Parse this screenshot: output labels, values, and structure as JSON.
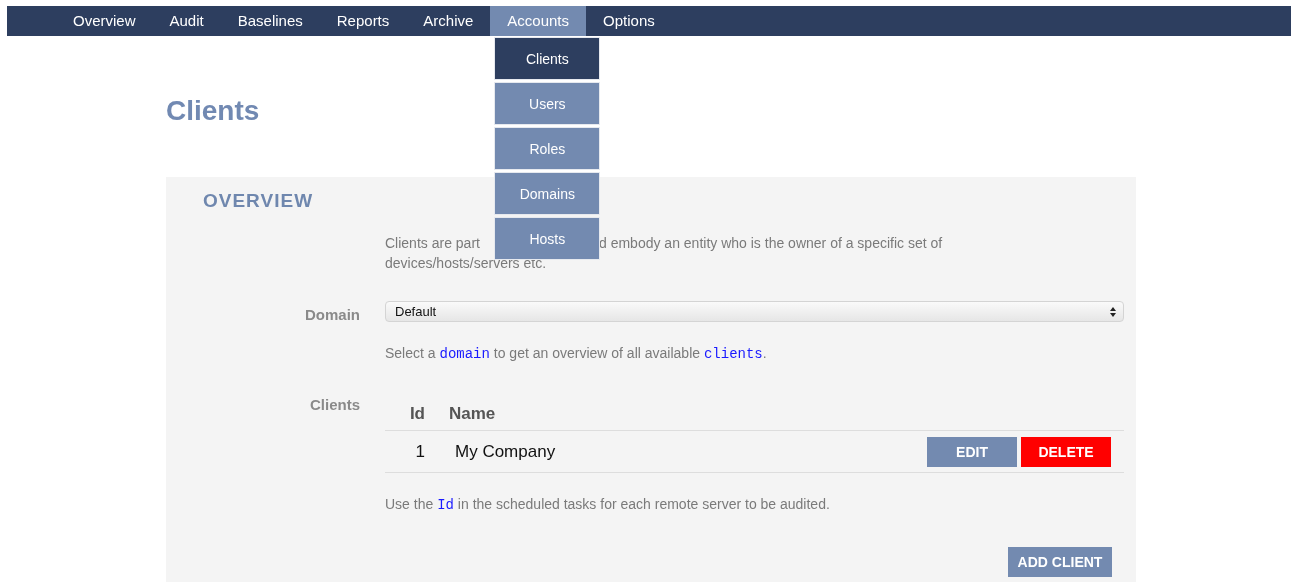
{
  "nav": {
    "items": [
      {
        "label": "Overview",
        "selected": false
      },
      {
        "label": "Audit",
        "selected": false
      },
      {
        "label": "Baselines",
        "selected": false
      },
      {
        "label": "Reports",
        "selected": false
      },
      {
        "label": "Archive",
        "selected": false
      },
      {
        "label": "Accounts",
        "selected": true,
        "open": true
      },
      {
        "label": "Options",
        "selected": false
      }
    ]
  },
  "dropdown": {
    "items": [
      {
        "label": "Clients",
        "selected": true
      },
      {
        "label": "Users",
        "selected": false
      },
      {
        "label": "Roles",
        "selected": false
      },
      {
        "label": "Domains",
        "selected": false
      },
      {
        "label": "Hosts",
        "selected": false
      }
    ]
  },
  "page_title": "Clients",
  "section": {
    "title": "OVERVIEW",
    "description": {
      "line_1_before": "Clients are part",
      "line_1_after": "d embody an entity who is the owner of a specific set of",
      "line_2": "devices/hosts/servers etc."
    },
    "domain": {
      "label": "Domain",
      "value": "Default"
    },
    "domain_hint": [
      {
        "kind": "text",
        "text": "Select a"
      },
      {
        "kind": "code",
        "text": "domain"
      },
      {
        "kind": "text",
        "text": "to get an overview of all available"
      },
      {
        "kind": "code",
        "text": "clients"
      },
      {
        "kind": "text",
        "text": "."
      }
    ],
    "clients": {
      "label": "Clients",
      "columns": [
        "Id",
        "Name"
      ],
      "rows": [
        {
          "id": "1",
          "name": "My Company",
          "actions": [
            {
              "kind": "edit",
              "label": "EDIT"
            },
            {
              "kind": "delete",
              "label": "DELETE"
            }
          ]
        }
      ]
    },
    "clients_note": [
      {
        "kind": "text",
        "text": "Use the"
      },
      {
        "kind": "code",
        "text": "Id"
      },
      {
        "kind": "text",
        "text": "in the scheduled tasks for each remote server to be audited."
      }
    ],
    "add_button": "ADD CLIENT"
  }
}
